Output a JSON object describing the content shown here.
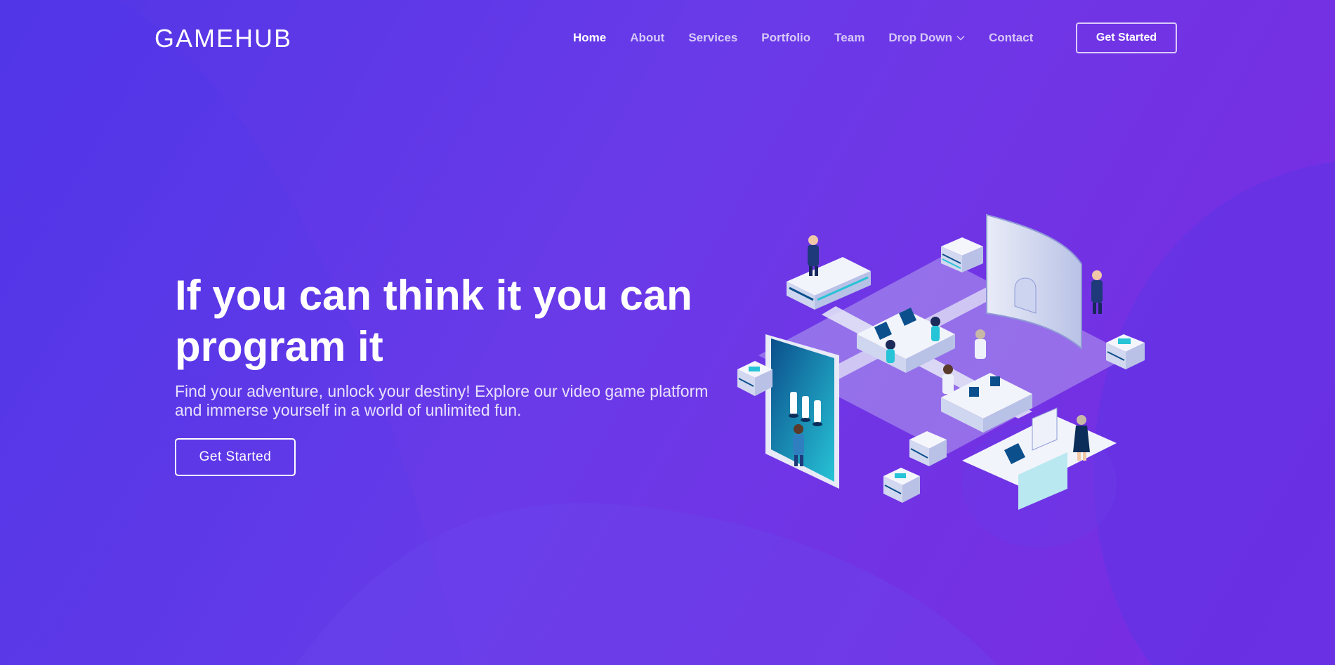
{
  "header": {
    "logo": "GAMEHUB",
    "nav": [
      {
        "label": "Home",
        "active": true
      },
      {
        "label": "About"
      },
      {
        "label": "Services"
      },
      {
        "label": "Portfolio"
      },
      {
        "label": "Team"
      },
      {
        "label": "Drop Down",
        "icon": "chevron-down-icon"
      },
      {
        "label": "Contact"
      }
    ],
    "cta_label": "Get Started"
  },
  "hero": {
    "title_line1": "If you can think it you can",
    "title_line2": "program it",
    "subtitle_line1": "Find your adventure, unlock your destiny! Explore our video game platform",
    "subtitle_line2": "and immerse yourself in a world of unlimited fun.",
    "cta_label": "Get Started",
    "illustration": "isometric-office-illustration"
  },
  "colors": {
    "background_start": "#5236e6",
    "background_end": "#7b2ae0",
    "accent_teal": "#27c3d6",
    "text": "#ffffff"
  }
}
